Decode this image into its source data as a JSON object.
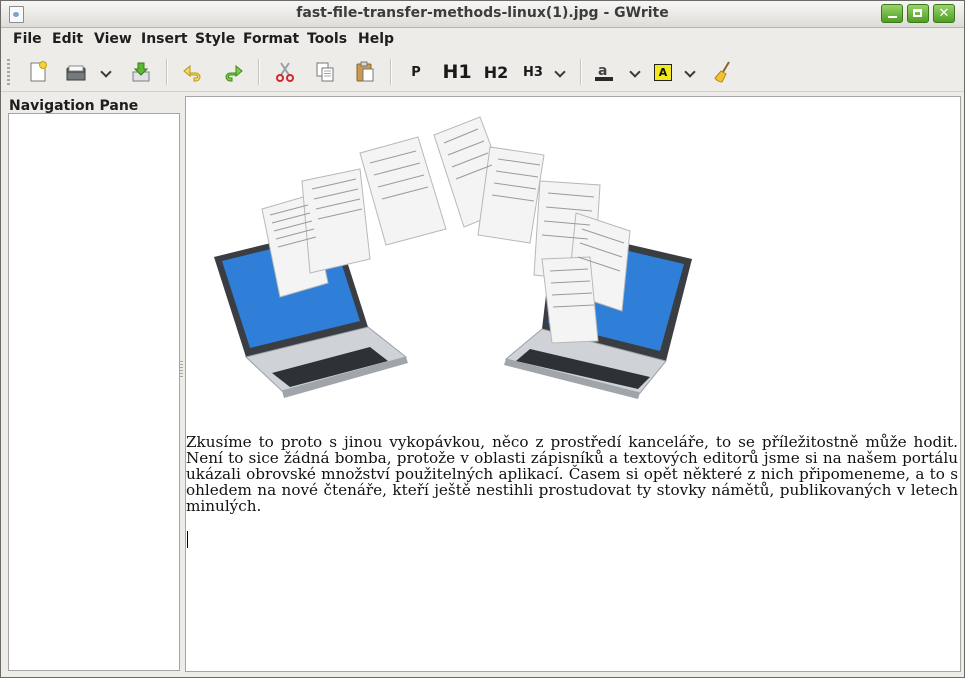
{
  "window": {
    "title": "fast-file-transfer-methods-linux(1).jpg - GWrite"
  },
  "menubar": {
    "items": [
      "File",
      "Edit",
      "View",
      "Insert",
      "Style",
      "Format",
      "Tools",
      "Help"
    ]
  },
  "toolbar": {
    "paragraph_label": "P",
    "h1_label": "H1",
    "h2_label": "H2",
    "h3_label": "H3",
    "highlight_label": "A"
  },
  "nav_pane": {
    "title": "Navigation Pane"
  },
  "document": {
    "paragraph": "Zkusíme to proto s jinou vykopávkou, něco z prostředí kanceláře, to se příležitostně může hodit. Není to sice žádná bomba, protože v oblasti zápisníků a textových editorů jsme si na našem portálu ukázali obrovské množství použitelných aplikací. Časem si opět některé z nich připomeneme, a to s ohledem na nové čtenáře, kteří ještě nestihli prostudovat ty stovky námětů, publikovaných v letech minulých."
  },
  "colors": {
    "accent_green": "#4f9e24",
    "screen_blue": "#2f7fd8"
  }
}
